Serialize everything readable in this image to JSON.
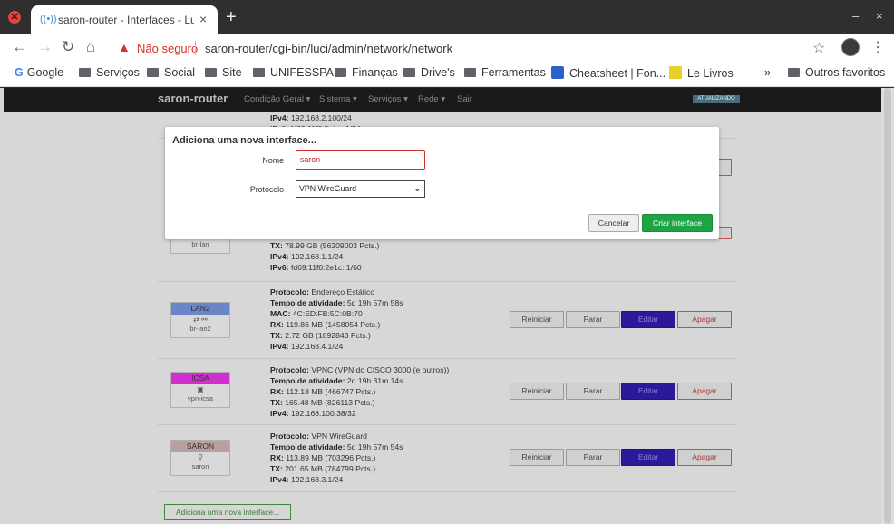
{
  "browser": {
    "tab_title": "saron-router - Interfaces - LuCI",
    "tab_close": "×",
    "new_tab": "+",
    "minimize": "–",
    "close": "×",
    "security_label": "Não seguro",
    "url": "saron-router/cgi-bin/luci/admin/network/network",
    "bookmarks": [
      {
        "label": "Google",
        "icon": "google-icon"
      },
      {
        "label": "Serviços",
        "icon": "folder-icon"
      },
      {
        "label": "Social",
        "icon": "folder-icon"
      },
      {
        "label": "Site",
        "icon": "folder-icon"
      },
      {
        "label": "UNIFESSPA",
        "icon": "folder-icon"
      },
      {
        "label": "Finanças",
        "icon": "folder-icon"
      },
      {
        "label": "Drive's",
        "icon": "folder-icon"
      },
      {
        "label": "Ferramentas",
        "icon": "folder-icon"
      },
      {
        "label": "Cheatsheet | Fon...",
        "icon": "flag-icon"
      },
      {
        "label": "Le Livros",
        "icon": "book-icon"
      }
    ],
    "more_bookmarks": "»",
    "other_bookmarks": "Outros favoritos"
  },
  "luci": {
    "brand": "saron-router",
    "menu": [
      "Condição Geral ▾",
      "Sistema ▾",
      "Serviços ▾",
      "Rede ▾",
      "Sair"
    ],
    "autorefresh": "ATUALIZANDO"
  },
  "interfaces": {
    "top_partial": {
      "ipv4": "192.168.2.100/24",
      "ipv6_clip": "IPv6: 1f69:11f0:2e1c::1/54"
    },
    "lan": {
      "device": "br-lan",
      "tx": "78.99 GB (56209003 Pcts.)",
      "ipv4": "192.168.1.1/24",
      "ipv6": "fd69:11f0:2e1c::1/60"
    },
    "lan2": {
      "name": "LAN2",
      "device": "br-lan2",
      "protocol": "Endereço Estático",
      "uptime": "5d 19h 57m 58s",
      "mac": "4C:ED:FB:5C:0B:70",
      "rx": "119.86 MB (1458054 Pcts.)",
      "tx": "2.72 GB (1892843 Pcts.)",
      "ipv4": "192.168.4.1/24"
    },
    "icsa": {
      "name": "ICSA",
      "device": "vpn-icsa",
      "protocol": "VPNC (VPN do CISCO 3000 (e outros))",
      "uptime": "2d 19h 31m 14s",
      "rx": "112.18 MB (466747 Pcts.)",
      "tx": "165.48 MB (826113 Pcts.)",
      "ipv4": "192.168.100.38/32"
    },
    "saron": {
      "name": "SARON",
      "device": "saron",
      "protocol": "VPN WireGuard",
      "uptime": "5d 19h 57m 54s",
      "rx": "113.89 MB (703296 Pcts.)",
      "tx": "201.65 MB (784799 Pcts.)",
      "ipv4": "192.168.3.1/24"
    },
    "labels": {
      "protocol": "Protocolo:",
      "uptime": "Tempo de atividade:",
      "mac": "MAC:",
      "rx": "RX:",
      "tx": "TX:",
      "ipv4": "IPv4:",
      "ipv6": "IPv6:"
    },
    "buttons": {
      "restart": "Reiniciar",
      "stop": "Parar",
      "edit": "Editar",
      "delete": "Apagar"
    },
    "add_button": "Adiciona uma nova interface..."
  },
  "colors": {
    "lan2": "#6a86c8",
    "icsa": "#d02ecf",
    "saron": "#b8a0a0"
  },
  "modal": {
    "title": "Adiciona uma nova interface...",
    "name_label": "Nome",
    "name_value": "saron",
    "protocol_label": "Protocolo",
    "protocol_value": "VPN WireGuard",
    "cancel": "Cancelar",
    "create": "Criar interface"
  }
}
